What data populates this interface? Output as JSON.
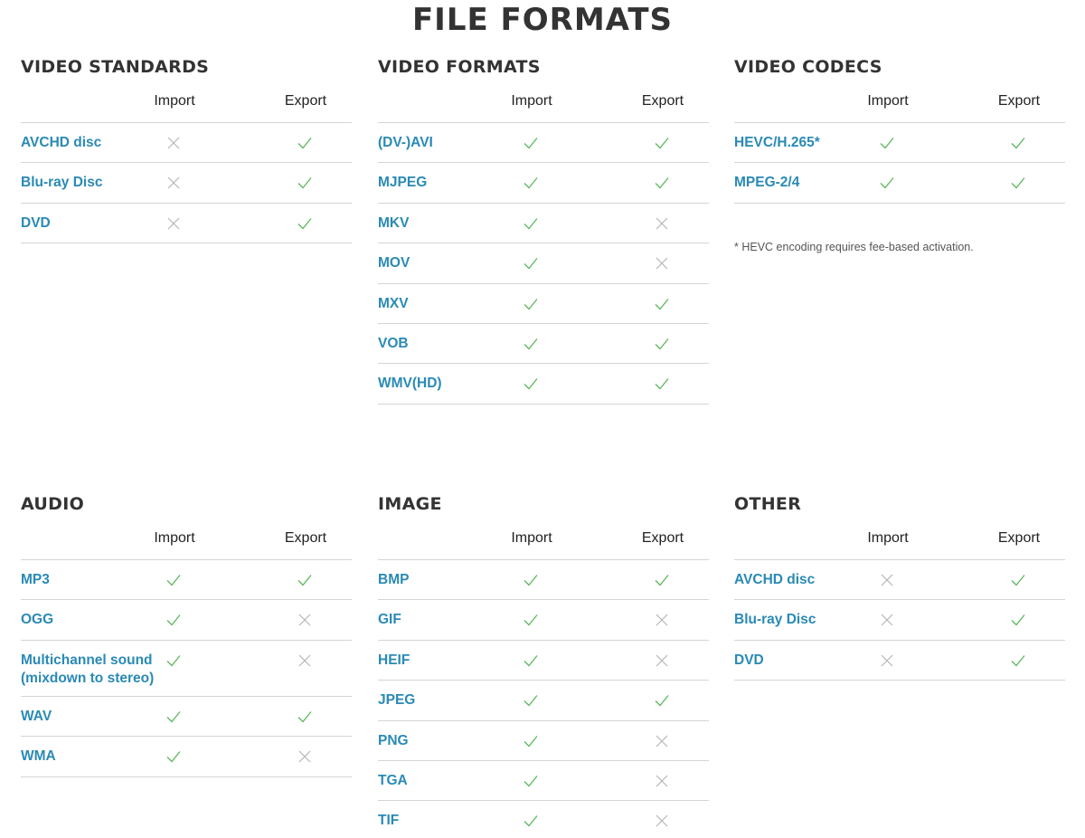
{
  "title": "FILE FORMATS",
  "headers": {
    "import": "Import",
    "export": "Export"
  },
  "sections": {
    "video_standards": {
      "title": "VIDEO STANDARDS",
      "rows": [
        {
          "label": "AVCHD disc",
          "import": false,
          "export": true
        },
        {
          "label": "Blu-ray Disc",
          "import": false,
          "export": true
        },
        {
          "label": "DVD",
          "import": false,
          "export": true
        }
      ]
    },
    "video_formats": {
      "title": "VIDEO FORMATS",
      "rows": [
        {
          "label": "(DV-)AVI",
          "import": true,
          "export": true
        },
        {
          "label": "MJPEG",
          "import": true,
          "export": true
        },
        {
          "label": "MKV",
          "import": true,
          "export": false
        },
        {
          "label": "MOV",
          "import": true,
          "export": false
        },
        {
          "label": "MXV",
          "import": true,
          "export": true
        },
        {
          "label": "VOB",
          "import": true,
          "export": true
        },
        {
          "label": "WMV(HD)",
          "import": true,
          "export": true
        }
      ]
    },
    "video_codecs": {
      "title": "VIDEO CODECS",
      "rows": [
        {
          "label": "HEVC/H.265*",
          "import": true,
          "export": true
        },
        {
          "label": "MPEG-2/4",
          "import": true,
          "export": true
        }
      ],
      "footnote": "* HEVC encoding requires fee-based activation."
    },
    "audio": {
      "title": "AUDIO",
      "rows": [
        {
          "label": "MP3",
          "import": true,
          "export": true
        },
        {
          "label": "OGG",
          "import": true,
          "export": false
        },
        {
          "label": "Multichannel sound (mixdown to stereo)",
          "import": true,
          "export": false
        },
        {
          "label": "WAV",
          "import": true,
          "export": true
        },
        {
          "label": "WMA",
          "import": true,
          "export": false
        }
      ]
    },
    "image": {
      "title": "IMAGE",
      "rows": [
        {
          "label": "BMP",
          "import": true,
          "export": true
        },
        {
          "label": "GIF",
          "import": true,
          "export": false
        },
        {
          "label": "HEIF",
          "import": true,
          "export": false
        },
        {
          "label": "JPEG",
          "import": true,
          "export": true
        },
        {
          "label": "PNG",
          "import": true,
          "export": false
        },
        {
          "label": "TGA",
          "import": true,
          "export": false
        },
        {
          "label": "TIF",
          "import": true,
          "export": false
        }
      ]
    },
    "other": {
      "title": "OTHER",
      "rows": [
        {
          "label": "AVCHD disc",
          "import": false,
          "export": true
        },
        {
          "label": "Blu-ray Disc",
          "import": false,
          "export": true
        },
        {
          "label": "DVD",
          "import": false,
          "export": true
        }
      ]
    }
  },
  "colors": {
    "accent": "#2a8ab5",
    "check": "#5cb85c",
    "cross": "#b5b5b5",
    "rule": "#d5d5d5"
  },
  "icons": {
    "supported": "check-icon",
    "unsupported": "cross-icon"
  }
}
